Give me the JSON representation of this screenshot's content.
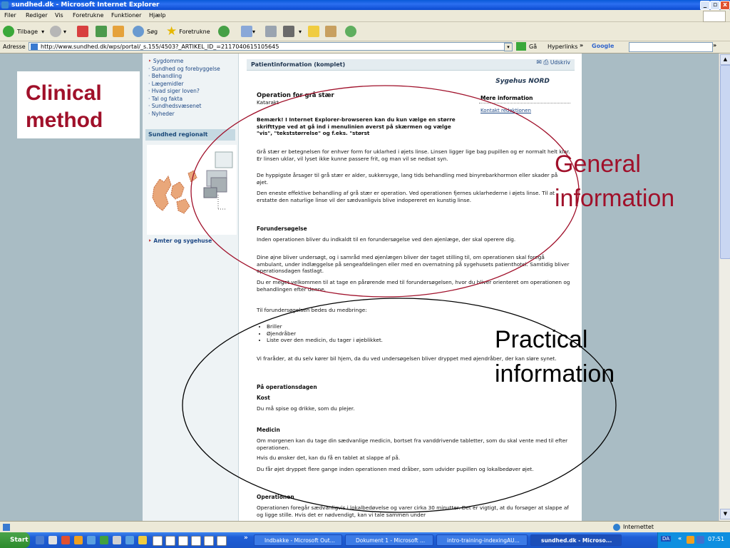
{
  "window": {
    "title": "sundhed.dk - Microsoft Internet Explorer",
    "buttons": [
      "_",
      "▫",
      "x"
    ]
  },
  "menu": [
    "Filer",
    "Rediger",
    "Vis",
    "Foretrukne",
    "Funktioner",
    "Hjælp"
  ],
  "toolbar": {
    "back": "Tilbage",
    "search": "Søg",
    "favorites": "Foretrukne"
  },
  "address": {
    "label": "Adresse",
    "url": "http://www.sundhed.dk/wps/portal/_s.155/4503?_ARTIKEL_ID_=2117040615105645",
    "go": "Gå",
    "links": "Hyperlinks",
    "google": "Google"
  },
  "nav": {
    "items": [
      "Sygdomme",
      "Sundhed og forebyggelse",
      "Behandling",
      "Lægemidler",
      "Hvad siger loven?",
      "Tal og fakta",
      "Sundhedsvæsenet",
      "Nyheder"
    ],
    "region_title": "Sundhed regionalt",
    "region_link": "Amter og sygehuse"
  },
  "article": {
    "header": "Patientinformation (komplet)",
    "print": "Udskriv",
    "logo": "Sygehus NORD",
    "more_info": "Mere information",
    "contact": "Kontakt redaktionen",
    "title": "Operation for grå stær",
    "subtitle": "Katarakt",
    "notice": "Bemærk! I Internet Explorer-browseren kan du kun vælge en større skrifttype ved at gå ind i menulinien øverst på skærmen og vælge \"vis\", \"tekststørrelse\" og f.eks. \"størst",
    "p1": "Grå stær er betegnelsen for enhver form for uklarhed i øjets linse. Linsen ligger lige bag pupillen og er normalt helt klar. Er linsen uklar, vil lyset ikke kunne passere frit, og man vil se nedsat syn.",
    "p2": "De hyppigste årsager til grå stær er alder, sukkersyge, lang tids behandling med binyrebarkhormon eller skader på øjet.",
    "p3": "Den eneste effektive behandling af grå stær er operation. Ved operationen fjernes uklarhederne i øjets linse. Til at erstatte den naturlige linse vil der sædvanligvis blive indopereret en kunstig linse.",
    "h_forund": "Forundersøgelse",
    "p4": "Inden operationen bliver du indkaldt til en forundersøgelse ved den øjenlæge, der skal operere dig.",
    "p5": "Dine øjne bliver undersøgt, og i samråd med øjenlægen bliver der taget stilling til, om operationen skal foregå ambulant, under indlæggelse på sengeafdelingen eller med en overnatning på sygehusets patienthotel. Samtidig bliver operationsdagen fastlagt.",
    "p6": "Du er meget velkommen til at tage en pårørende med til forundersøgelsen, hvor du bliver orienteret om operationen og behandlingen efter denne.",
    "p7": "Til forundersøgelsen bedes du medbringe:",
    "bullets": [
      "Briller",
      "Øjendråber",
      "Liste over den medicin, du tager i øjeblikket."
    ],
    "p8": "Vi fraråder, at du selv kører bil hjem, da du ved undersøgelsen bliver dryppet med øjendråber, der kan sløre synet.",
    "h_opdag": "På operationsdagen",
    "h_kost": "Kost",
    "p9": "Du må spise og drikke, som du plejer.",
    "h_medicin": "Medicin",
    "p10": "Om morgenen kan du tage din sædvanlige medicin, bortset fra vanddrivende tabletter, som du skal vente med til efter operationen.",
    "p11": "Hvis du ønsker det, kan du få en tablet at slappe af på.",
    "p12": "Du får øjet dryppet flere gange inden operationen med dråber, som udvider pupillen og lokalbedøver øjet.",
    "h_oper": "Operationen",
    "p13": "Operationen foregår sædvanligvis i lokalbedøvelse og varer cirka 30 minutter. Det er vigtigt, at du forsøger at slappe af og ligge stille. Hvis det er nødvendigt, kan vi tale sammen under"
  },
  "status": {
    "zone": "Internettet"
  },
  "taskbar": {
    "start": "Start",
    "tasks": [
      "Indbakke - Microsoft Out...",
      "Dokument 1 - Microsoft ...",
      "intro-training-indexingAU...",
      "sundhed.dk - Microso..."
    ],
    "lang": "DA",
    "time": "07:51"
  },
  "annotations": {
    "clinical": "Clinical method",
    "general": "General information",
    "practical": "Practical information"
  },
  "colors": {
    "annotation_red": "#a0102a",
    "link_blue": "#204a86",
    "xp_blue": "#0a5ad8"
  }
}
